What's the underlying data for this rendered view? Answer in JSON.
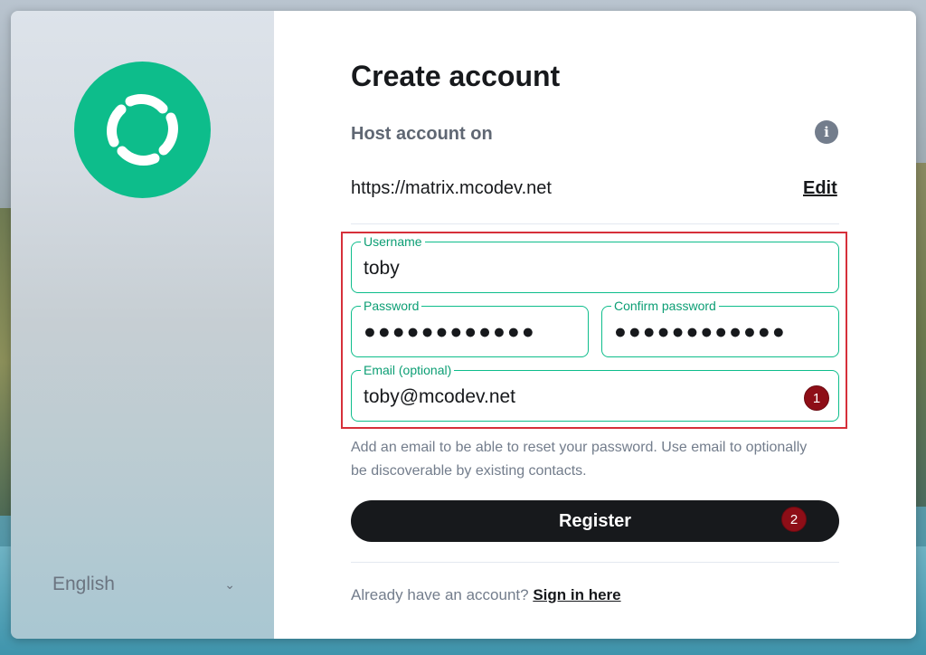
{
  "sidebar": {
    "language": "English"
  },
  "form": {
    "title": "Create account",
    "host_label": "Host account on",
    "server_url": "https://matrix.mcodev.net",
    "edit_label": "Edit",
    "fields": {
      "username": {
        "label": "Username",
        "value": "toby"
      },
      "password": {
        "label": "Password",
        "value": "●●●●●●●●●●●●"
      },
      "confirm_password": {
        "label": "Confirm password",
        "value": "●●●●●●●●●●●●"
      },
      "email": {
        "label": "Email (optional)",
        "value": "toby@mcodev.net"
      }
    },
    "email_help": "Add an email to be able to reset your password. Use email to optionally be discoverable by existing contacts.",
    "register_label": "Register",
    "signin_prompt": "Already have an account?",
    "signin_link": "Sign in here"
  },
  "annotations": {
    "marker1": "1",
    "marker2": "2"
  },
  "colors": {
    "accent": "#0dbd8b",
    "highlight": "#d6303a",
    "marker": "#8e0e17",
    "button": "#17191c"
  }
}
